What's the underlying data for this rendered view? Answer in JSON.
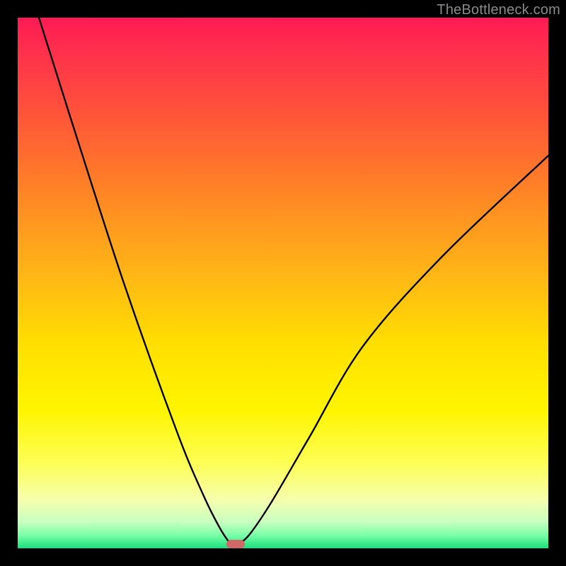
{
  "watermark": "TheBottleneck.com",
  "chart_data": {
    "type": "line",
    "title": "",
    "xlabel": "",
    "ylabel": "",
    "xlim": [
      0,
      100
    ],
    "ylim": [
      0,
      100
    ],
    "grid": false,
    "legend": false,
    "series": [
      {
        "name": "curve",
        "x": [
          4,
          10,
          20,
          30,
          35,
          38,
          40,
          41,
          42,
          44,
          48,
          55,
          65,
          80,
          100
        ],
        "y": [
          100,
          81,
          50,
          22,
          10,
          4,
          1,
          0.5,
          1,
          3,
          9,
          21,
          38,
          55,
          74
        ]
      }
    ],
    "marker": {
      "x": 41,
      "y": 0.5
    },
    "background_gradient": {
      "top": "#ff1a55",
      "middle": "#ffe000",
      "bottom": "#18e07a"
    }
  }
}
